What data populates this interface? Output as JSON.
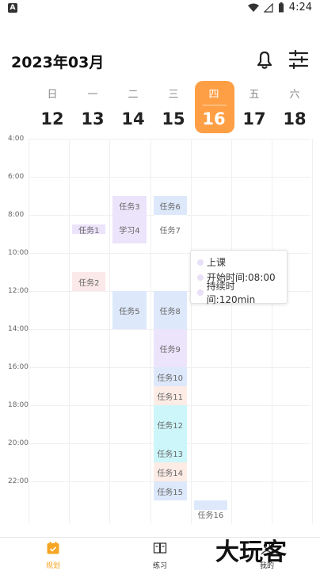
{
  "status_bar": {
    "time": "4:24",
    "left_icon": "A"
  },
  "header": {
    "month_title": "2023年03月"
  },
  "week": [
    {
      "weekday": "日",
      "date": "12",
      "selected": false
    },
    {
      "weekday": "一",
      "date": "13",
      "selected": false
    },
    {
      "weekday": "二",
      "date": "14",
      "selected": false
    },
    {
      "weekday": "三",
      "date": "15",
      "selected": false
    },
    {
      "weekday": "四",
      "date": "16",
      "selected": true
    },
    {
      "weekday": "五",
      "date": "17",
      "selected": false
    },
    {
      "weekday": "六",
      "date": "18",
      "selected": false
    }
  ],
  "time_labels": [
    "4:00",
    "6:00",
    "8:00",
    "10:00",
    "12:00",
    "14:00",
    "16:00",
    "18:00",
    "20:00",
    "22:00"
  ],
  "events": [
    {
      "label": "任务1",
      "day": 1,
      "start": "8:30",
      "end": "9:00",
      "color": "#ece4fb"
    },
    {
      "label": "任务2",
      "day": 1,
      "start": "11:00",
      "end": "12:00",
      "color": "#fbe8e8"
    },
    {
      "label": "任务3",
      "day": 2,
      "start": "7:00",
      "end": "8:00",
      "color": "#ece4fb"
    },
    {
      "label": "学习4",
      "day": 2,
      "start": "8:00",
      "end": "9:30",
      "color": "#ece4fb"
    },
    {
      "label": "任务5",
      "day": 2,
      "start": "12:00",
      "end": "14:00",
      "color": "#dde8fb"
    },
    {
      "label": "任务6",
      "day": 3,
      "start": "7:00",
      "end": "8:00",
      "color": "#dde8fb"
    },
    {
      "label": "任务7",
      "day": 3,
      "start": "8:00",
      "end": "9:30",
      "color": "#ffffff"
    },
    {
      "label": "任务8",
      "day": 3,
      "start": "12:00",
      "end": "14:00",
      "color": "#dde8fb"
    },
    {
      "label": "任务9",
      "day": 3,
      "start": "14:00",
      "end": "16:00",
      "color": "#ece4fb"
    },
    {
      "label": "任务10",
      "day": 3,
      "start": "16:00",
      "end": "17:00",
      "color": "#dde8fb"
    },
    {
      "label": "任务11",
      "day": 3,
      "start": "17:00",
      "end": "18:00",
      "color": "#fdece6"
    },
    {
      "label": "任务12",
      "day": 3,
      "start": "18:00",
      "end": "20:00",
      "color": "#cdf6fa"
    },
    {
      "label": "任务13",
      "day": 3,
      "start": "20:00",
      "end": "21:00",
      "color": "#cdf6fa"
    },
    {
      "label": "任务14",
      "day": 3,
      "start": "21:00",
      "end": "22:00",
      "color": "#fdece6"
    },
    {
      "label": "任务15",
      "day": 3,
      "start": "22:00",
      "end": "23:00",
      "color": "#dde8fb"
    },
    {
      "label": "任务16",
      "day": 4,
      "start": "23:00",
      "end": "23:30",
      "color": "#dde8fb"
    }
  ],
  "popup": {
    "title": "上课",
    "start": "开始时间:08:00",
    "duration": "持续时间:120min"
  },
  "bottom_nav": [
    {
      "label": "规划",
      "icon": "calendar-check-icon",
      "active": true
    },
    {
      "label": "练习",
      "icon": "book-icon",
      "active": false
    },
    {
      "label": "我的",
      "icon": "user-icon",
      "active": false
    }
  ],
  "watermark": "大玩客",
  "colors": {
    "accent": "#ff9f45",
    "active_nav": "#f5a623"
  }
}
